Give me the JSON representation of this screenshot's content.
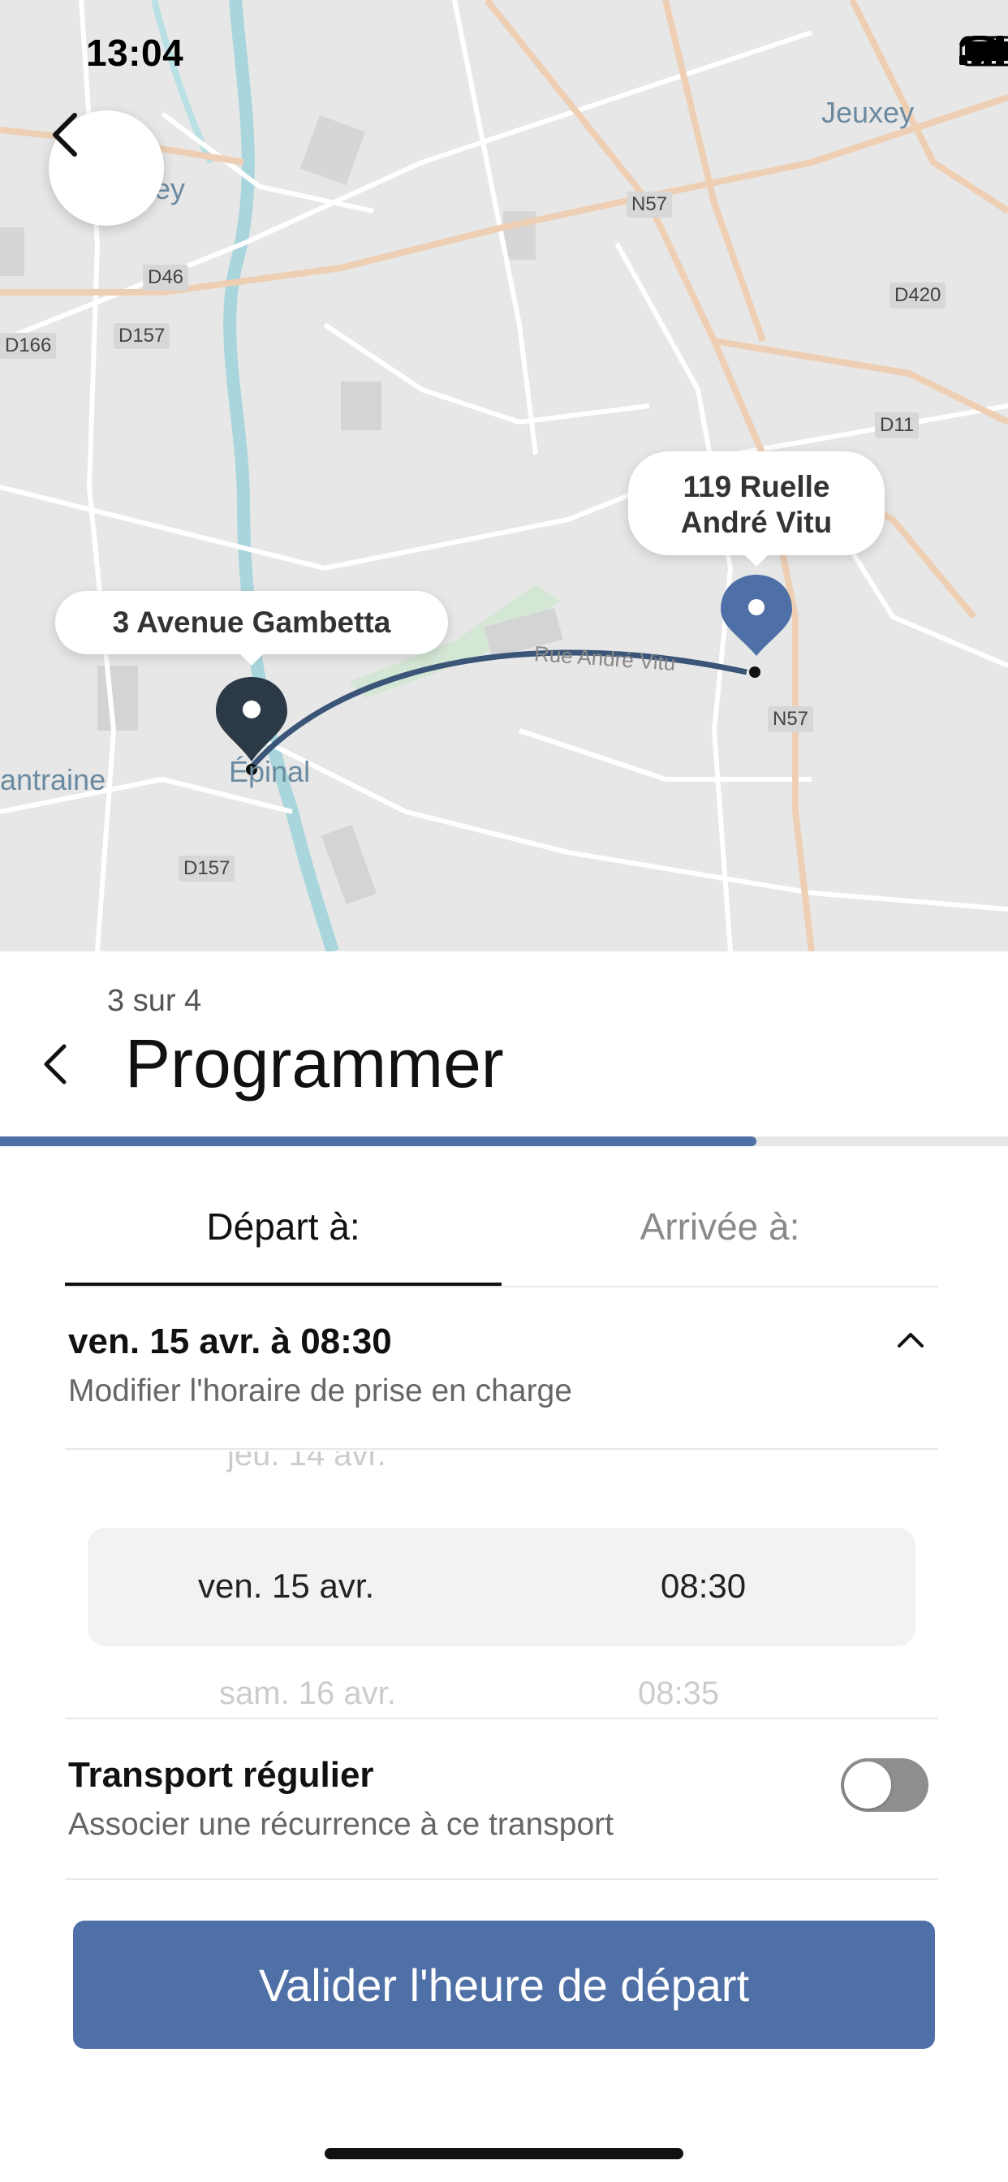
{
  "status_bar": {
    "time": "13:04"
  },
  "map": {
    "places": {
      "jeuxey": "Jeuxey",
      "epinal": "Épinal",
      "chantraine": "antraine",
      "partial_top": "ey"
    },
    "roads": {
      "n57_top": "N57",
      "d46": "D46",
      "d420": "D420",
      "d166": "D166",
      "d157_top": "D157",
      "d11": "D11",
      "n57_bottom": "N57",
      "d157_bottom": "D157",
      "street": "Rue André Vitu"
    },
    "origin_label": "3 Avenue Gambetta",
    "destination_label_line1": "119 Ruelle",
    "destination_label_line2": "André Vitu",
    "route_color": "#3b5578",
    "origin_pin_color": "#2c3a48",
    "destination_pin_color": "#4f70a7"
  },
  "header": {
    "step": "3 sur 4",
    "title": "Programmer",
    "progress": 0.75
  },
  "tabs": {
    "departure": "Départ à:",
    "arrival": "Arrivée à:",
    "active": "departure"
  },
  "schedule": {
    "selected_summary": "ven. 15 avr. à 08:30",
    "subtitle": "Modifier l'horaire de prise en charge"
  },
  "picker": {
    "prev_date": "jeu. 14 avr.",
    "selected_date": "ven. 15 avr.",
    "selected_time": "08:30",
    "next_date": "sam. 16 avr.",
    "next_time": "08:35"
  },
  "recurrence": {
    "title": "Transport régulier",
    "subtitle": "Associer une récurrence à ce transport",
    "enabled": false
  },
  "cta": {
    "label": "Valider l'heure de départ"
  },
  "colors": {
    "accent": "#4f70a7",
    "map_bg": "#e7e7e7",
    "major_road": "#eecfb4"
  }
}
